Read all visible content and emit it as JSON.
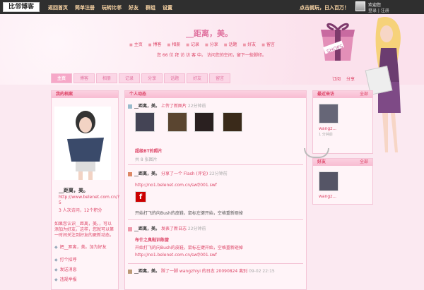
{
  "top": {
    "logo": "比邻博客",
    "nav": [
      "返回首页",
      "简单注册",
      "玩转比邻",
      "好友",
      "群组",
      "设置"
    ],
    "promo": "点击就玩，日入百万！",
    "welcome": "欢迎您",
    "login": "登录 | 注册"
  },
  "header": {
    "title": "__距离，美。",
    "quicklinks": [
      "主页",
      "博客",
      "相册",
      "记录",
      "分享",
      "话题",
      "好友",
      "留言"
    ],
    "visit": "您 66 位 拜 访 访 客 中。 访问您的空间，留下一些脚印。"
  },
  "tabs": [
    "主页",
    "博客",
    "相册",
    "记录",
    "分享",
    "话题",
    "好友",
    "留言"
  ],
  "subscribe": [
    "订阅",
    "分享"
  ],
  "left": {
    "title": "我的档案",
    "name": "__距离，美。",
    "url": "http://www.belenet.com.cn/?5",
    "stat": "3 人次访问，12个积分",
    "bio": "如果您认识__距离，美。，可以添加为好友。这样，您就可以第一时间关注到好友的更新动态。",
    "add_friend": "把__距离，美。加为好友",
    "links": [
      "打个招呼",
      "发送消息",
      "违规举报"
    ]
  },
  "mid": {
    "title": "个人动态",
    "item1": {
      "user": "__距离，美。",
      "action": "上传了新图片",
      "time": "22分钟前",
      "album": "超级BT的照片",
      "count": "共 8 张图片"
    },
    "item2": {
      "user": "__距离，美。",
      "action": "分享了一个 Flash (评论)",
      "time": "22分钟前",
      "link": "http://no1.belenet.com.cn/swf/001.swf",
      "quote": "开始打飞的向Bush的皮鞋，鼠标左键开始，空格重新砸掉"
    },
    "item3": {
      "user": "__距离，美。",
      "action": "发表了新日志",
      "time": "22分钟前",
      "title": "布什之臭鞋训练营",
      "text": "开始打飞的向Bush的皮鞋，鼠标左键开始，空格重新砸掉 http://no1.belenet.com.cn/swf/001.swf"
    },
    "item4": {
      "user": "__距离，美。",
      "action": "踩了一脚 wangzhiyi 的日志 20090824",
      "extra": "离别",
      "time": "09-02 22:15"
    }
  },
  "right": {
    "visitors_title": "最近来访",
    "visitors_more": "全部",
    "visitor_name": "wangz...",
    "visitor_time": "1 分钟前",
    "friends_title": "好友",
    "friends_more": "全部",
    "friend_name": "wangz..."
  }
}
